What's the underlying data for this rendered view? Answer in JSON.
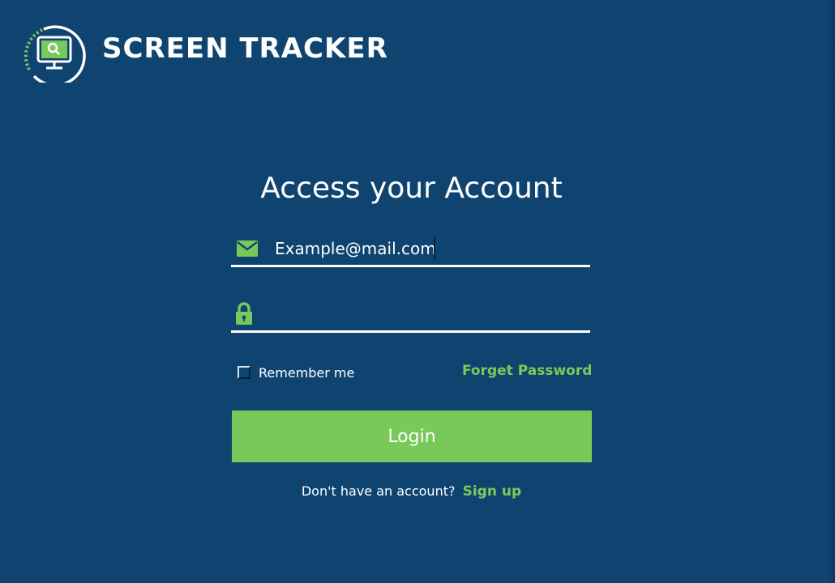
{
  "brand": {
    "name": "SCREEN TRACKER",
    "logo_icon": "monitor-search-logo-icon"
  },
  "login": {
    "title": "Access your Account",
    "email": {
      "icon": "envelope-icon",
      "value": "Example@mail.com"
    },
    "password": {
      "icon": "lock-icon",
      "value": ""
    },
    "remember_label": "Remember me",
    "remember_checked": false,
    "forgot_label": "Forget Password",
    "login_label": "Login",
    "signup_prompt": "Don't have an account?",
    "signup_label": "Sign up"
  },
  "colors": {
    "background": "#0f4471",
    "accent": "#79c95a",
    "text": "#ffffff"
  }
}
